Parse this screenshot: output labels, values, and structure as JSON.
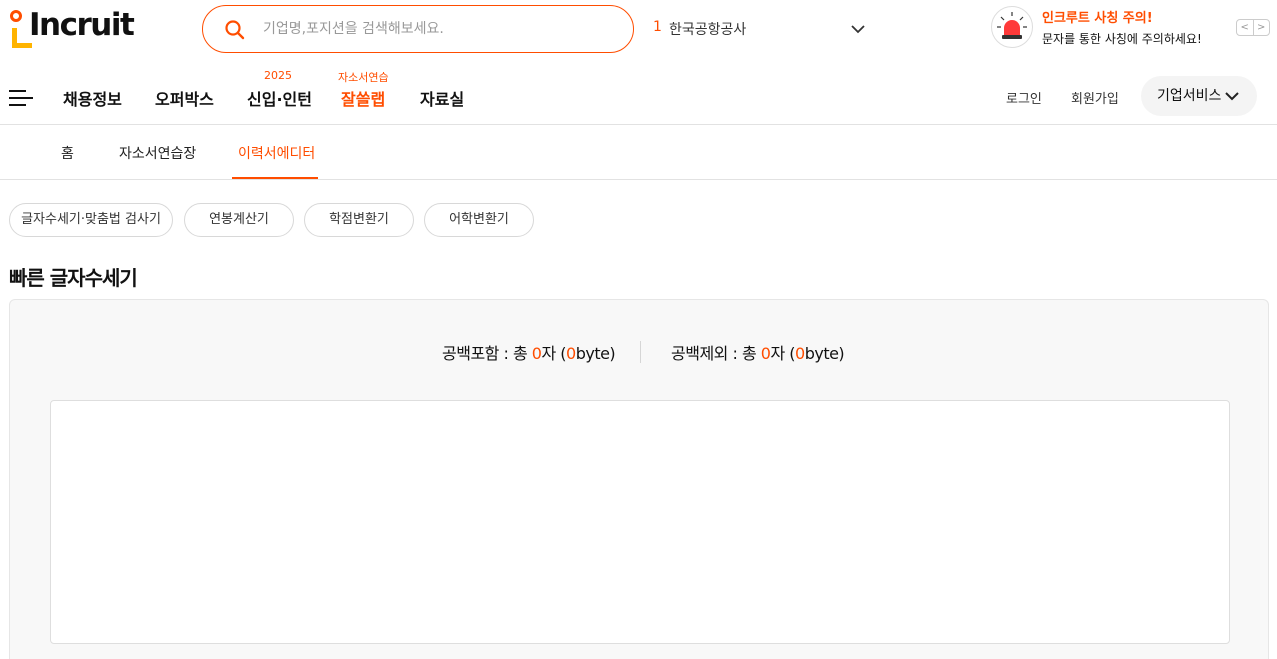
{
  "header": {
    "logo_text": "Incruit",
    "search": {
      "placeholder": "기업명,포지션을 검색해보세요."
    },
    "ranking": {
      "rank": "1",
      "text": "한국공항공사"
    },
    "notice": {
      "title": "인크루트 사칭 주의!",
      "text": "문자를 통한 사칭에 주의하세요!"
    },
    "notice_prev": "<",
    "notice_next": ">"
  },
  "gnb": {
    "items": [
      {
        "label": "채용정보",
        "sup": ""
      },
      {
        "label": "오퍼박스",
        "sup": ""
      },
      {
        "label": "신입·인턴",
        "sup": "2025"
      },
      {
        "label": "잘쓸랩",
        "sup": "자소서연습"
      },
      {
        "label": "자료실",
        "sup": ""
      }
    ],
    "login": "로그인",
    "signup": "회원가입",
    "biz_service": "기업서비스"
  },
  "lnb": {
    "items": [
      "홈",
      "자소서연습장",
      "이력서에디터"
    ],
    "active_index": 2
  },
  "tools": [
    "글자수세기·맞춤법 검사기",
    "연봉계산기",
    "학점변환기",
    "어학변환기"
  ],
  "counter": {
    "title": "빠른 글자수세기",
    "with_space": {
      "label": "공백포함 : 총 ",
      "chars": "0",
      "unit": "자 (",
      "bytes": "0",
      "byte_unit": "byte)"
    },
    "without_space": {
      "label": "공백제외 : 총 ",
      "chars": "0",
      "unit": "자 (",
      "bytes": "0",
      "byte_unit": "byte)"
    },
    "editor_value": ""
  },
  "colors": {
    "accent": "#ff4d00",
    "logo_yellow": "#ffb400"
  }
}
